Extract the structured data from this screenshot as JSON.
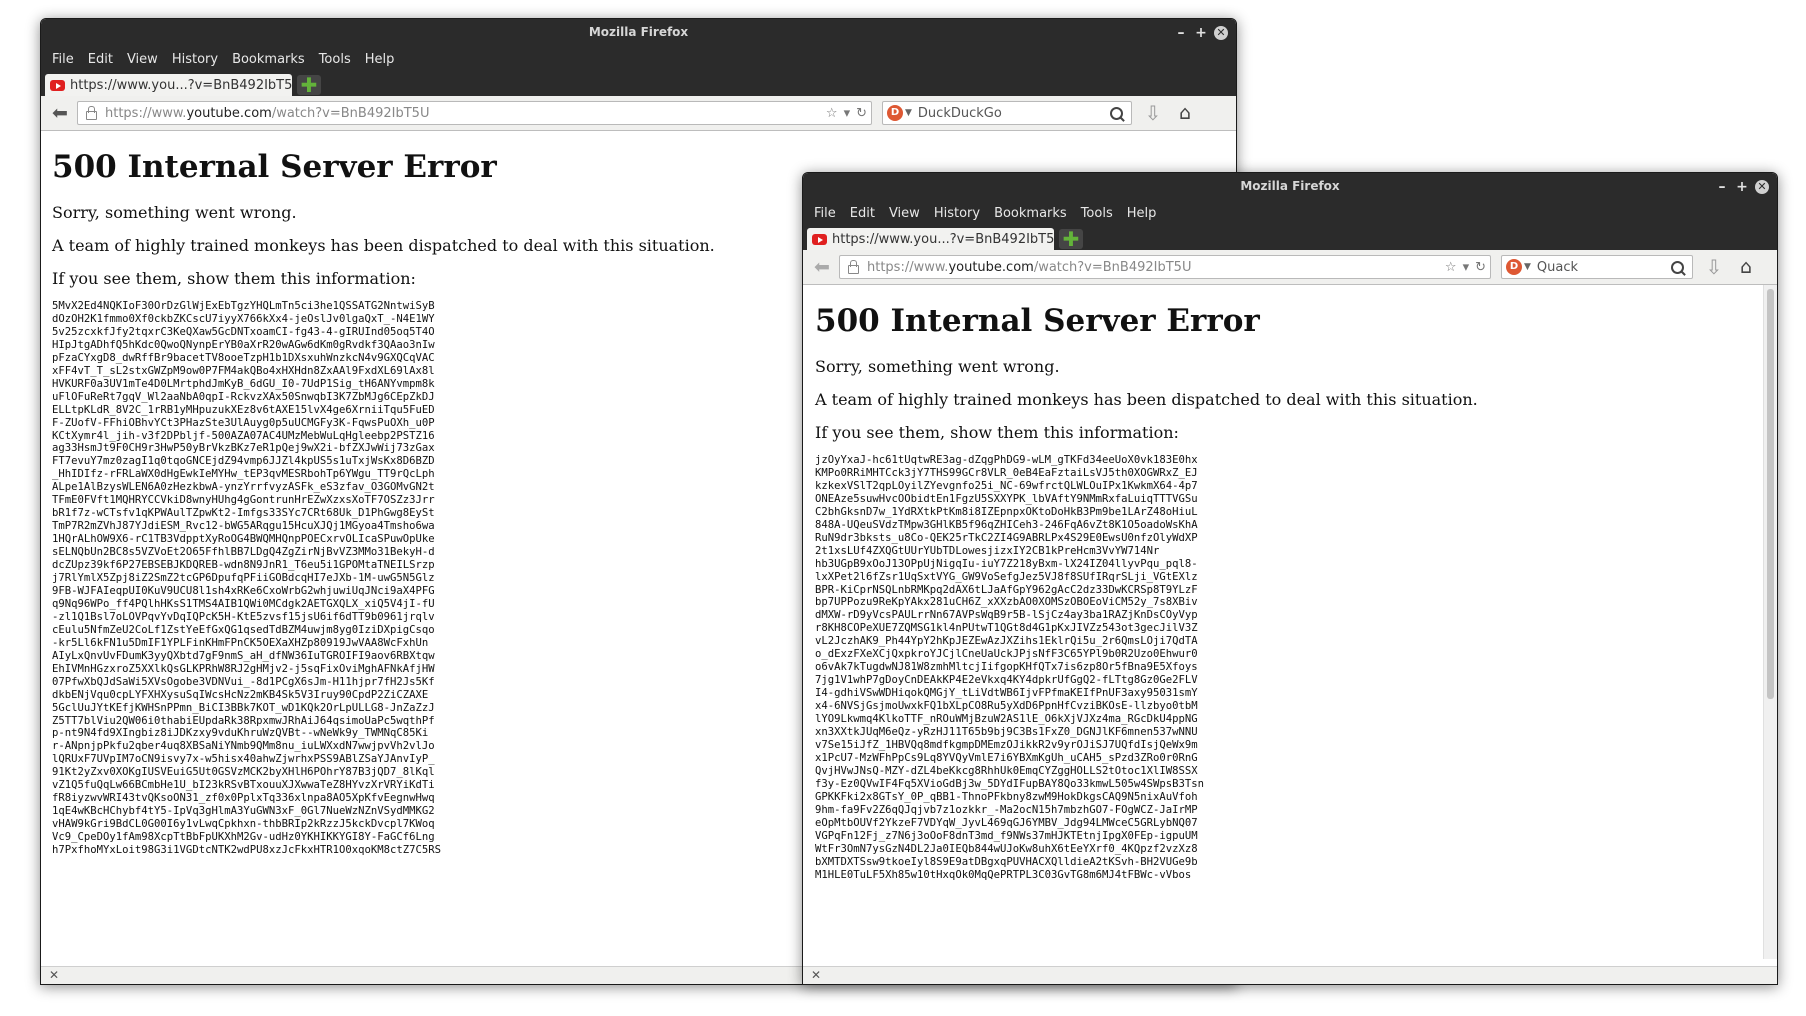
{
  "windows": [
    {
      "title": "Mozilla Firefox",
      "menu": [
        "File",
        "Edit",
        "View",
        "History",
        "Bookmarks",
        "Tools",
        "Help"
      ],
      "tab_title": "https://www.you...?v=BnB492IbT5U",
      "url_prefix": "https://www.",
      "url_domain": "youtube.com",
      "url_suffix": "/watch?v=BnB492IbT5U",
      "search_engine": "DuckDuckGo",
      "error": {
        "heading": "500 Internal Server Error",
        "line1": "Sorry, something went wrong.",
        "line2": "A team of highly trained monkeys has been dispatched to deal with this situation.",
        "line3": "If you see them, show them this information:",
        "traceback": "5MvX2Ed4NQKIoF30OrDzGlWjExEbTgzYHQLmTn5ci3he1QSSATG2NntwiSyB\ndOzOH2K1fmmo0Xf0ckbZKCscU7iyyX766kXx4-jeOslJv0lgaQxT_-N4E1WY\n5v25zcxkfJfy2tqxrC3KeQXaw5GcDNTxoamCI-fg43-4-gIRUInd05oq5T4O\nHIpJtgADhfQ5hKdc0QwoQNynpErYB0aXrR20wAGw6dKm0gRvdkf3QAao3nIw\npFzaCYxgD8_dwRffBr9bacetTV8ooeTzpH1b1DXsxuhWnzkcN4v9GXQCqVAC\nxFF4vT_T_sL2stxGWZpM9ow0P7FM4akQBo4xHXHdn8ZxAAl9FxdXL69lAx8l\nHVKURF0a3UV1mTe4D0LMrtphdJmKyB_6dGU_I0-7UdP1Sig_tH6ANYvmpm8k\nuFlOFuReRt7gqV_Wl2aaNbA0qpI-RckvzXAx50SnwqbI3K7ZbMJg6CEpZkDJ\nELLtpKLdR_8V2C_1rRB1yMHpuzukXEz8v6tAXE15lvX4ge6XrniiTqu5FuED\nF-ZUofV-FFhiOBhvYCt3PHazSte3UlAuyg0p5uUCMGFy3K-FqwsPuOXh_u0P\nKCtXymr4l_jih-v3f2DPbljf-500AZA07AC4UMzMebWuLqHgleebp2PSTZ16\nag33HsmJt9F0CH9r3HwP50yBrVkzBKz7eR1pQej9wX2i-bfZXJwWij73zGax\nFT7evuY7mz0zagI1q0tqoGNCEjdZ94vmp6JJZl4kpUS5s1uTxjWsKx8D6BZD\n_HhIDIfz-rFRLaWX0dHgEwkIeMYHw_tEP3qvMESRbohTp6YWgu_TT9rQcLph\nALpe1AlBzysWLEN6A0zHezkbwA-ynzYrrfvyzASFk_eS3zfav_O3GOMvGN2t\nTFmE0FVft1MQHRYCCVkiD8wnyHUhg4gGontrunHrEZwXzxsXoTF7OSZz3Jrr\nbR1f7z-wCTsfv1qKPWAulTZpwKt2-Imfgs33SYc7CRt68Uk_D1PhGwg8EySt\nTmP7R2mZVhJ87YJdiESM_Rvc12-bWG5ARqgu15HcuXJQj1MGyoa4Tmsho6wa\n1HQrALhOW9X6-rC1TB3VdpptXyRoOG4BWQMHQnpPOECxrvOLIcaSPuwOpUke\nsELNQbUn2BC8s5VZVoEt2O65FfhlBB7LDgQ4ZgZirNjBvVZ3MMo31BekyH-d\ndcZUpz39kf6P27EBSEBJKDQREB-wdn8N9JnR1_T6eu5i1GPOMtaTNEILSrzp\nj7RlYmlX5Zpj8iZ2SmZ2tcGP6DpufqPFiiGOBdcqHI7eJXb-1M-uwG5N5Glz\n9FB-WJFAIeqpUI0KuV9UCU8l1sh4xRKe6CxoWrbG2whjuwiUqJNci9aX4PFG\nq9Nq96WPo_ff4PQlhHKsS1TMS4AIB1QWi0MCdgk2AETGXQLX_xiQ5V4jI-fU\n-zl1Q1Bsl7oLOVPqvYvDqIQPcK5H-KtE5zvsf15jsU6if6dTT9b0961jrqlv\ncEulu5NfmZeU2CoLf1ZstYeEfGxQG1qsedTdBZM4uwjm8yg0IziDXpigCsqo\n-kr5Ll6kFN1u5DmIF1YPLFinKHmFPnCK5OEXaXHZp80919JwVAA8WcFxhUn\nAIyLxQnvUvFDumK3yyQXbtd7gF9nmS_aH_dfNW36IuTGROIFI9aov6RBXtqw\nEhIVMnHGzxroZ5XXlkQsGLKPRhW8RJ2gHMjv2-j5sqFixOviMghAFNkAfjHW\n07PfwXbQJdSaWi5XVsOgobe3VDNVui_-8d1PCgX6sJm-H11hjpr7fH2Js5Kf\ndkbENjVqu0cpLYFXHXysuSqIWcsHcNz2mKB4Sk5V3Iruy90CpdP2ZiCZAXE\n5GclUuJYtKEfjKWHSnPPmn_BiCI3BBk7KOT_wD1KQk2OrLpULLG8-JnZaZzJ\nZ5TT7blViu2QW06i0thabiEUpdaRk38RpxmwJRhAiJ64qsimoUaPc5wqthPf\np-nt9N4fd9XIngbiz8iJDKzxy9vduKhruWzQVBt--wNeWk9y_TWMNqC85Ki\nr-ANpnjpPkfu2qber4uq8XBSaNiYNmb9QMm8nu_iuLWXxdN7wwjpvVh2vlJo\nlQRUxF7UVpIM7oCN9isvy7x-w5hisx40ahwZjwrhxPSS9ABlZSaYJAnvIyP_\n91Kt2yZxv0XOKgIUSVEuiG5Ut0GSVzMCK2byXHlH6POhrY87B3jQD7_8lKql\nvZ1Q5fuQqLw66BCmbHe1U_bI23kRSvBTxouuXJXwwaTeZ8HYvzXrVRYiKdTi\nfR8iyzwvWRI43tvQKsoON31_zf0x0PplxTq336xlnpa8AO5XpKfvEegnwHwq\n1qE4wKBcHChybf4tY5-IpVq3gHlmA3YuGWN3xF_0Gl7NueWzNZnVSydMMKG2\nvHAW9kGri9BdCL0G00I6y1vLwqCpkhxn-thbBRIp2kRzzJ5kckDvcpl7KWoq\nVc9_CpeDOy1fAm98XcpTtBbFpUKXhM2Gv-udHz0YKHIKKYGI8Y-FaGCf6Lng\nh7PxfhoMYxLoit98G3i1VGDtcNTK2wdPU8xzJcFkxHTR1O0xqoKM8ctZ7C5RS"
      }
    },
    {
      "title": "Mozilla Firefox",
      "menu": [
        "File",
        "Edit",
        "View",
        "History",
        "Bookmarks",
        "Tools",
        "Help"
      ],
      "tab_title": "https://www.you...?v=BnB492IbT5U",
      "url_prefix": "https://www.",
      "url_domain": "youtube.com",
      "url_suffix": "/watch?v=BnB492IbT5U",
      "search_engine": "Quack",
      "error": {
        "heading": "500 Internal Server Error",
        "line1": "Sorry, something went wrong.",
        "line2": "A team of highly trained monkeys has been dispatched to deal with this situation.",
        "line3": "If you see them, show them this information:",
        "traceback": "jzOyYxaJ-hc61tUqtwRE3ag-dZqgPhDG9-wLM_gTKFd34eeUoX0vk183E0hx\nKMPo0RRiMHTCck3jY7THS99GCr8VLR_0eB4EaFztaiLsVJ5th0XOGWRxZ_EJ\nkzkexVSlT2qpLOyilZYevgnfo25i_NC-69wfrctQLWLOuIPx1KwkmX64-4p7\nONEAze5suwHvcOObidtEn1FgzU5SXXYPK_lbVAftY9NMmRxfaLuiqTTTVGSu\nC2bhGksnD7w_1YdRXtkPtKm8i8IZEpnpxOKtoDoHkB3Pm9be1LArZ48oHiuL\n848A-UQeuSVdzTMpw3GHlKB5f96qZHICeh3-246FqA6vZt8K1O5oadoWsKhA\nRuN9dr3bksts_u8Co-QEK25rTkC2ZI4G9ABRLPx4S29E0EwsU0nfzOlyWdXP\n2t1xsLUf4ZXQGtUUrYUbTDLowesjizxIY2CB1kPreHcm3VvYW714Nr\nhb3UGpB9xOoJ13OPpUjNigqIu-iuY7Z218yBxm-lX24IZ04llyvPqu_pql8-\nlxXPet2l6fZsr1UqSxtVYG_GW9VoSefgJez5VJ8f8SUfIRqrSLji_VGtEXlz\nBPR-KiCprNSQLnbRMKpq2dAX6tLJaAfGpY962gAcC2dz33DwKCRSp8T9YLzF\nbp7UPPozu9ReKpYAkx281uCH6Z_xXXzbAO0XOMSzOBOEoViCM52y_7s8XBiv\ndMXW-rD9yVcsPAULrrNn67AVPsWqB9r5B-lSjCz4ay3ba1RAZjKnDsCOyVyp\nr8KH8COPeXUE7ZQMSG1kl4nPUtwT1QGt8d4G1pKxJIVZz543ot3gecJilV3Z\nvL2JczhAK9_Ph44YpY2hKpJEZEwAzJXZihs1EklrQi5u_2r6QmsLOji7QdTA\no_dExzFXeXCjQxpkroYJCjlCneUaUckJPjsNfF3C65YPl9b0R2Uzo0Ehwur0\no6vAk7kTugdwNJ81W8zmhMltcjIifgopKHfQTx7is6zp8Or5fBna9E5Xfoys\n7jg1V1whP7gDoyCnDEAkKP4E2eVkxq4KY4dpkrUfGgQ2-fLTtg8Gz0Ge2FLV\nI4-gdhiVSwWDHiqokQMGjY_tLiVdtWB6IjvFPfmaKEIfPnUF3axy95031smY\nx4-6NVSjGsjmoUwxkFQ1bXLpCO8Ru5yXdD6PpnHfCvziBKOsE-llzbyo0tbM\nlYO9Lkwmq4KlkoTTF_nROuWMjBzuW2AS1lE_O6kXjVJXz4ma_RGcDkU4ppNG\nxn3XXtkJUqM6eQz-yRzHJ11T65b9bj9C3Bs1FxZ0_DGNJlKF6mnen537wNNU\nv7Se15iJfZ_1HBVQq8mdfkgmpDMEmzOJikkR2v9yrOJiSJ7UQfdIsjQeWx9m\nx1PcU7-MzWFhPpCs9Lq8YVQyVmlE7i6YBXmKgUh_uCAH5_sPzd3ZRo0r0RnG\nQvjHVwJNsQ-MZY-dZL4beKkcg8RhhUk0EmqCYZggHOLLS2tOtoc1XlIW8SSX\nf3y-Ez0QVwIF4Fq5XVioGdBj3w_5DYdIFupBAY8Qo33kmwL505w4SWpsB3Tsn\nGPKKFki2x8GTsY_0P_qBB1-ThnoPFkbny8zwM9HokDkgsCAQ9N5nixAuVfoh\n9hm-fa9Fv2Z6qQJqjvb7z1ozkkr_-Ma2ocN15h7mbzhGO7-FOgWCZ-JaIrMP\neOpMtbOUVf2YkzeF7VDYqW_JyvL469qGJ6YMBV_Jdg94LMWceC5GRLybNQ07\nVGPqFn12Fj_z7N6j3oOoF8dnT3md_f9NWs37mHJKTEtnjIpgX0FEp-igpuUM\nWtFr3OmN7ysGzN4DL2Ja0IEQb844wUJoKw8uhX6tEeYXrf0_4KQpzf2vzXz8\nbXMTDXTSsw9tkoeIyl8S9E9atDBgxqPUVHACXQlldieA2tKSvh-BH2VUGe9b\nM1HLE0TuLF5Xh85w10tHxqOk0MqQePRTPL3C03GvTG8m6MJ4tFBWc-vVbos"
      }
    }
  ]
}
